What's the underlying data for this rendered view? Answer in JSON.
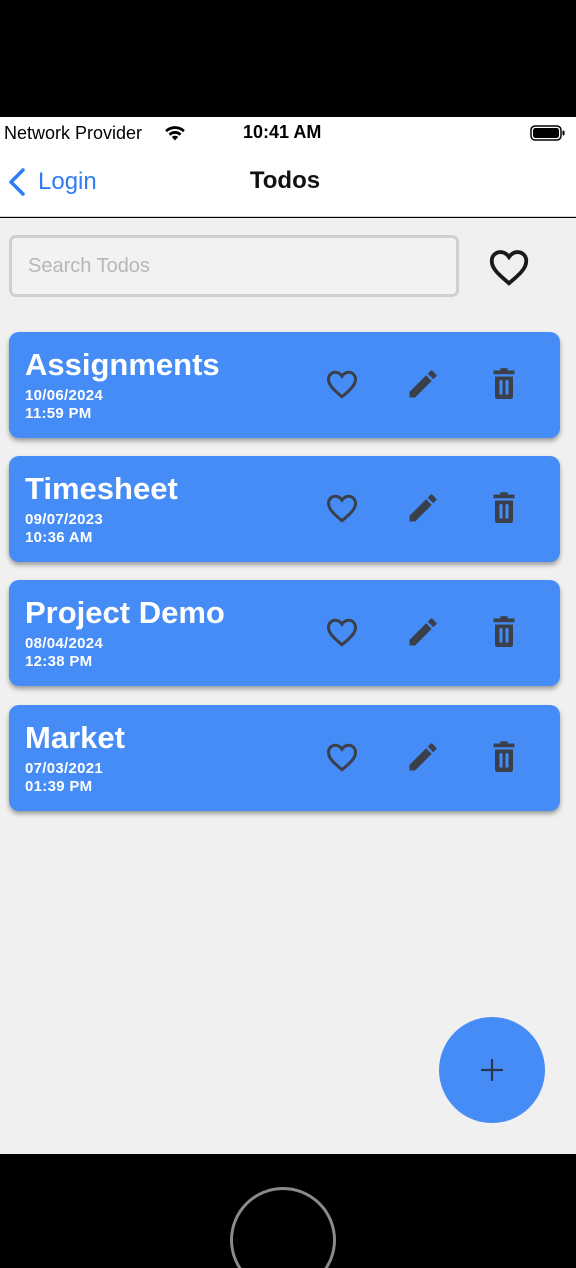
{
  "status_bar": {
    "carrier": "Network Provider",
    "time": "10:41 AM"
  },
  "nav": {
    "back_label": "Login",
    "title": "Todos"
  },
  "search": {
    "placeholder": "Search Todos",
    "value": ""
  },
  "todos": [
    {
      "name": "Assignments",
      "date": "10/06/2024",
      "time": "11:59 PM"
    },
    {
      "name": "Timesheet",
      "date": "09/07/2023",
      "time": "10:36 AM"
    },
    {
      "name": "Project Demo",
      "date": "08/04/2024",
      "time": "12:38 PM"
    },
    {
      "name": "Market",
      "date": "07/03/2021",
      "time": "01:39 PM"
    }
  ],
  "icons": {
    "favorite_filter": "heart-outline-icon",
    "card_favorite": "heart-outline-icon",
    "card_edit": "pencil-icon",
    "card_delete": "trash-icon",
    "fab": "plus-icon"
  },
  "colors": {
    "accent": "#468cf6",
    "link": "#2f7cf6",
    "background": "#f0f0f0",
    "icon": "#3a3f4a"
  }
}
